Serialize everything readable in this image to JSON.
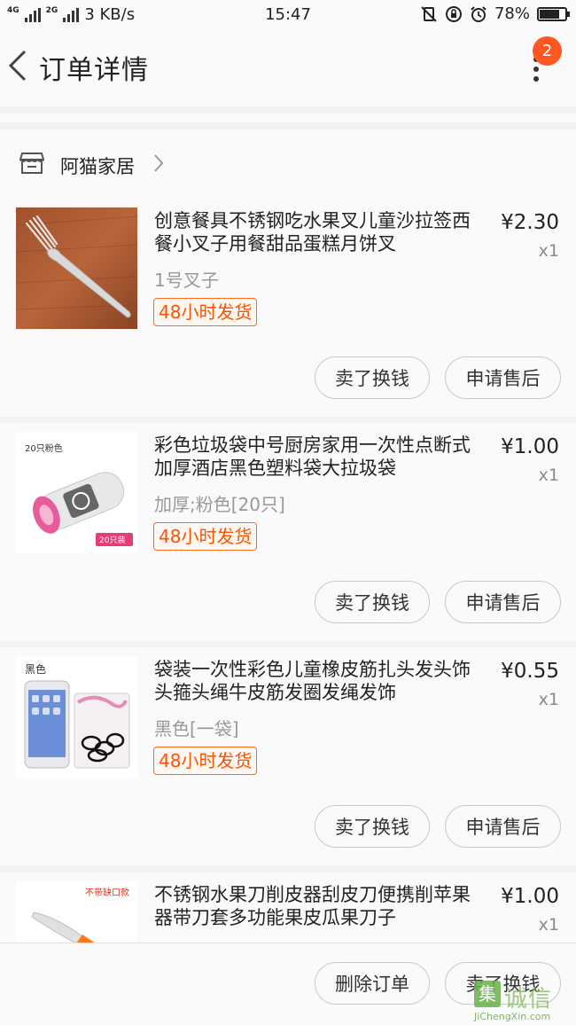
{
  "status_bar": {
    "net_top": "4G",
    "net_bottom": "2G",
    "speed": "3 KB/s",
    "time": "15:47",
    "battery": "78%",
    "battery_level": 0.78
  },
  "header": {
    "title": "订单详情",
    "badge": "2"
  },
  "shop": {
    "name": "阿猫家居"
  },
  "items": [
    {
      "title": "创意餐具不锈钢吃水果叉儿童沙拉签西餐小叉子用餐甜品蛋糕月饼叉",
      "price": "¥2.30",
      "qty": "x1",
      "sku": "1号叉子",
      "ship": "48小时发货",
      "btn_sell": "卖了换钱",
      "btn_after": "申请售后"
    },
    {
      "title": "彩色垃圾袋中号厨房家用一次性点断式加厚酒店黑色塑料袋大拉圾袋",
      "price": "¥1.00",
      "qty": "x1",
      "sku": "加厚;粉色[20只]",
      "ship": "48小时发货",
      "btn_sell": "卖了换钱",
      "btn_after": "申请售后",
      "thumb_label": "20只粉色",
      "thumb_tag": "20只装"
    },
    {
      "title": "袋装一次性彩色儿童橡皮筋扎头发头饰头箍头绳牛皮筋发圈发绳发饰",
      "price": "¥0.55",
      "qty": "x1",
      "sku": "黑色[一袋]",
      "ship": "48小时发货",
      "btn_sell": "卖了换钱",
      "btn_after": "申请售后",
      "thumb_label": "黑色"
    },
    {
      "title": "不锈钢水果刀削皮器刮皮刀便携削苹果器带刀套多功能果皮瓜果刀子",
      "price": "¥1.00",
      "qty": "x1",
      "thumb_label": "不带缺口款"
    }
  ],
  "bottom_bar": {
    "delete": "删除订单",
    "sell": "卖了换钱"
  },
  "watermark": {
    "text": "诚信",
    "box": "集",
    "sub": "JiChengXin.com"
  },
  "colors": {
    "accent": "#ff5000",
    "badge": "#ff5722"
  }
}
